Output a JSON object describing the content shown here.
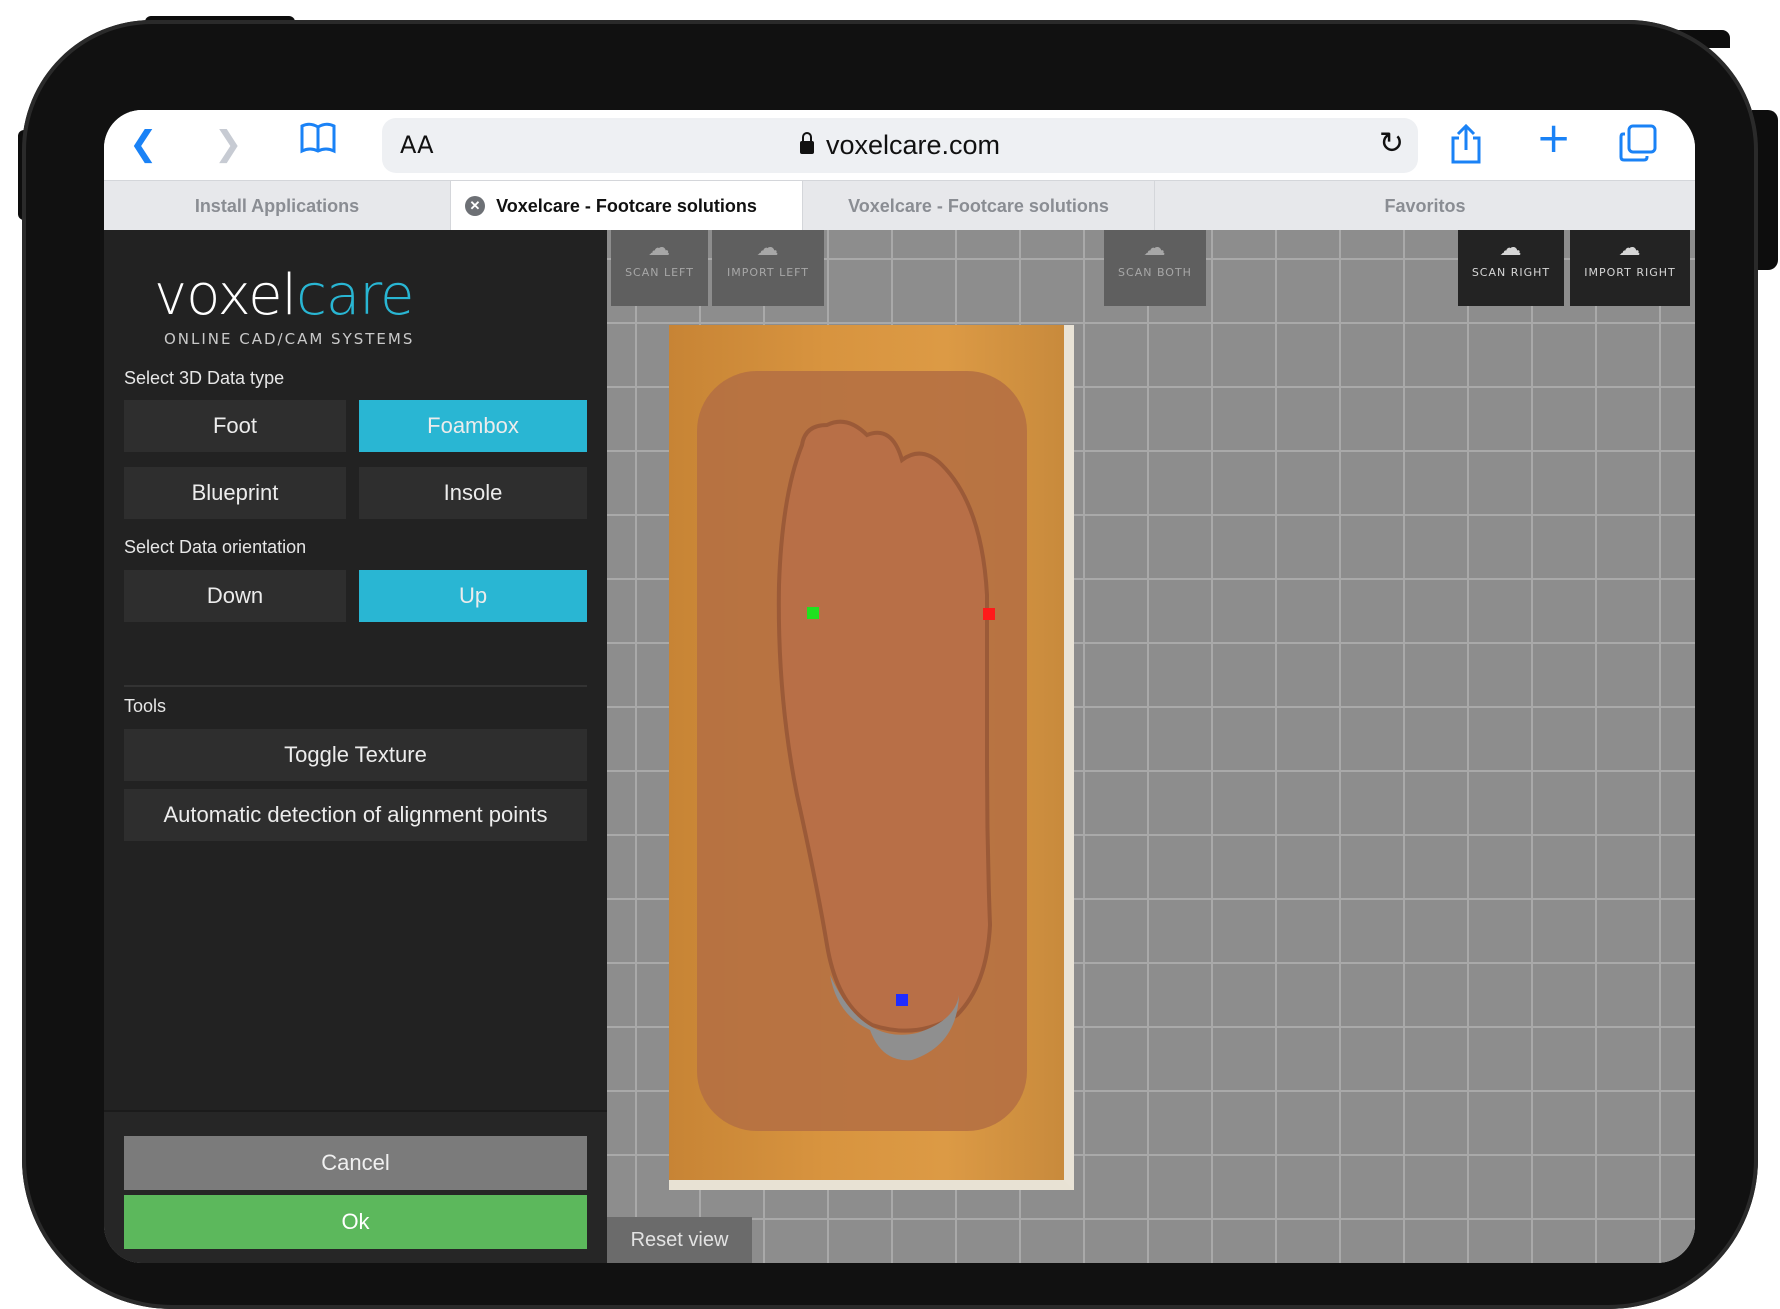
{
  "browser": {
    "text_size_button": "AA",
    "url": "voxelcare.com",
    "tabs": [
      {
        "label": "Install Applications",
        "active": false
      },
      {
        "label": "Voxelcare - Footcare solutions",
        "active": true
      },
      {
        "label": "Voxelcare - Footcare solutions",
        "active": false
      },
      {
        "label": "Favoritos",
        "active": false
      }
    ]
  },
  "logo": {
    "brand_part1": "voxel",
    "brand_part2": "care",
    "tagline": "ONLINE CAD/CAM SYSTEMS",
    "accent_color": "#29b6d3"
  },
  "sidebar": {
    "data_type_label": "Select 3D Data type",
    "data_types": [
      "Foot",
      "Foambox",
      "Blueprint",
      "Insole"
    ],
    "selected_data_type": "Foambox",
    "orientation_label": "Select Data orientation",
    "orientations": [
      "Down",
      "Up"
    ],
    "selected_orientation": "Up",
    "tools_label": "Tools",
    "tools": [
      "Toggle Texture",
      "Automatic detection of alignment points"
    ],
    "cancel_label": "Cancel",
    "ok_label": "Ok"
  },
  "viewport": {
    "buttons": [
      {
        "label": "SCAN LEFT",
        "enabled": false
      },
      {
        "label": "IMPORT LEFT",
        "enabled": false
      },
      {
        "label": "SCAN BOTH",
        "enabled": false
      },
      {
        "label": "SCAN RIGHT",
        "enabled": true
      },
      {
        "label": "IMPORT RIGHT",
        "enabled": true
      }
    ],
    "reset_label": "Reset view",
    "alignment_points": [
      {
        "color": "#1fe21f"
      },
      {
        "color": "#ff1a1a"
      },
      {
        "color": "#1f2cff"
      }
    ]
  }
}
